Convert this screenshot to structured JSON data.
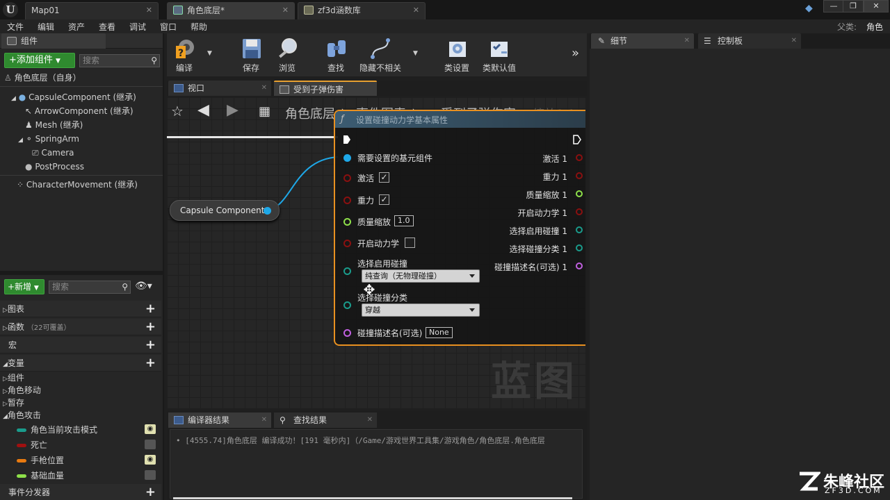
{
  "window": {
    "tabs": [
      "Map01",
      "角色底层*",
      "zf3d涵数库"
    ],
    "controls": [
      "—",
      "❐",
      "✕"
    ]
  },
  "menu": [
    "文件",
    "编辑",
    "资产",
    "查看",
    "调试",
    "窗口",
    "帮助"
  ],
  "parent_class": {
    "label": "父类:",
    "value": "角色"
  },
  "components_panel": {
    "title": "组件",
    "add_button": "+添加组件",
    "search_placeholder": "搜索",
    "root": "角色底层（自身）",
    "items": [
      "CapsuleComponent (继承)",
      "ArrowComponent (继承)",
      "Mesh (继承)",
      "SpringArm",
      "Camera",
      "PostProcess",
      "CharacterMovement (继承)"
    ]
  },
  "myblueprint_panel": {
    "new_button": "+新增",
    "search_placeholder": "搜索",
    "categories": {
      "graphs": "图表",
      "functions": "函数",
      "functions_note": "（22可覆盖）",
      "macros": "宏",
      "variables": "变量"
    },
    "var_groups": [
      "组件",
      "角色移动",
      "暂存",
      "角色攻击"
    ],
    "variables": [
      {
        "name": "角色当前攻击模式",
        "color": "#1a9c8c"
      },
      {
        "name": "死亡",
        "color": "#a01010"
      },
      {
        "name": "手枪位置",
        "color": "#e87a10"
      },
      {
        "name": "基础血量",
        "color": "#8ee04a"
      }
    ],
    "dispatchers": "事件分发器"
  },
  "toolbar": {
    "buttons": [
      "编译",
      "保存",
      "浏览",
      "查找",
      "隐藏不相关",
      "类设置",
      "类默认值"
    ]
  },
  "editor_tabs": {
    "viewport": "视口",
    "graph": "受到子弹伤害"
  },
  "breadcrumb": [
    "角色底层",
    "事件图表",
    "受到子弹伤害"
  ],
  "zoom_label": "缩放1:1",
  "watermark": "蓝图",
  "capsule_node": {
    "label": "Capsule Component"
  },
  "node": {
    "title": "设置碰撞动力学基本属性",
    "target_label": "需要设置的基元组件",
    "inputs": {
      "active": "激活",
      "gravity": "重力",
      "mass": "质量缩放",
      "mass_value": "1.0",
      "physics": "开启动力学",
      "collision_enable": "选择启用碰撞",
      "collision_enable_value": "纯查询（无物理碰撞）",
      "collision_class": "选择碰撞分类",
      "collision_class_value": "穿越",
      "description": "碰撞描述名(可选)",
      "description_value": "None"
    },
    "outputs": [
      "激活 1",
      "重力 1",
      "质量缩放 1",
      "开启动力学 1",
      "选择启用碰撞 1",
      "选择碰撞分类 1",
      "碰撞描述名(可选) 1"
    ]
  },
  "details_panel": {
    "title": "细节"
  },
  "palette_panel": {
    "title": "控制板"
  },
  "bottom_tabs": {
    "compiler": "编译器结果",
    "find": "查找结果"
  },
  "compiler_log": "[4555.74]角色底层 编译成功！[191 毫秒内]（/Game/游戏世界工具集/游戏角色/角色底层.角色底层",
  "branding": {
    "name": "朱峰社区",
    "url": "ZF3D.COM"
  }
}
